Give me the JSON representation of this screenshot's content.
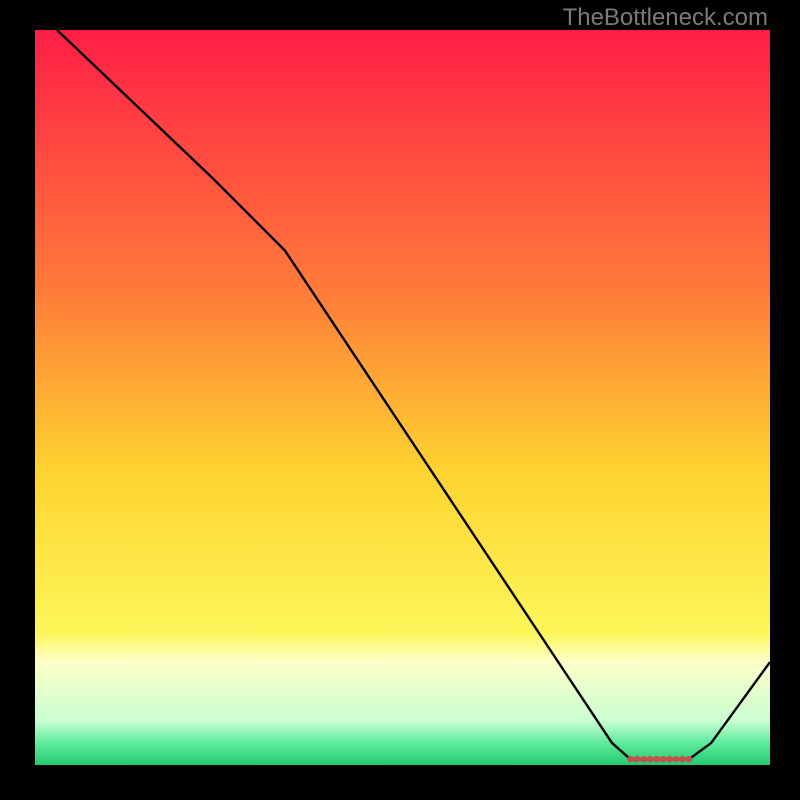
{
  "watermark": "TheBottleneck.com",
  "chart_data": {
    "type": "line",
    "title": "",
    "xlabel": "",
    "ylabel": "",
    "xlim": [
      0,
      100
    ],
    "ylim": [
      0,
      100
    ],
    "grid": false,
    "axes_visible": false,
    "legend": false,
    "background_gradient": {
      "stops": [
        {
          "pos": 0.0,
          "color": "#ff1e46"
        },
        {
          "pos": 0.35,
          "color": "#ff7a3a"
        },
        {
          "pos": 0.6,
          "color": "#fed330"
        },
        {
          "pos": 0.82,
          "color": "#fdf65a"
        },
        {
          "pos": 0.86,
          "color": "#feffc8"
        },
        {
          "pos": 0.94,
          "color": "#c9ffd2"
        },
        {
          "pos": 0.97,
          "color": "#5eeb9c"
        },
        {
          "pos": 1.0,
          "color": "#24c971"
        }
      ]
    },
    "series": [
      {
        "name": "curve",
        "points": [
          {
            "x": 3.0,
            "y": 100.0
          },
          {
            "x": 24.0,
            "y": 80.0
          },
          {
            "x": 34.0,
            "y": 70.0
          },
          {
            "x": 78.5,
            "y": 3.0
          },
          {
            "x": 81.0,
            "y": 0.8
          },
          {
            "x": 89.0,
            "y": 0.8
          },
          {
            "x": 92.0,
            "y": 3.0
          },
          {
            "x": 100.0,
            "y": 14.0
          }
        ]
      }
    ],
    "flat_markers": {
      "y": 0.8,
      "x_start": 81.0,
      "x_end": 89.0,
      "count": 10,
      "color": "#c4504e"
    }
  }
}
